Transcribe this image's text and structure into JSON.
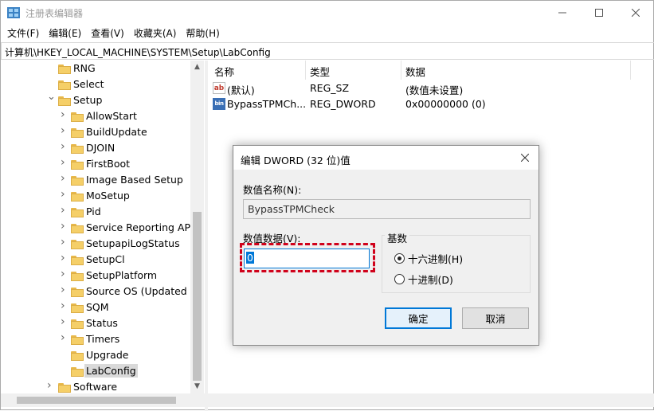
{
  "window": {
    "title": "注册表编辑器",
    "minimize": "—",
    "maximize": "☐",
    "close": "✕"
  },
  "menu": [
    "文件(F)",
    "编辑(E)",
    "查看(V)",
    "收藏夹(A)",
    "帮助(H)"
  ],
  "address": "计算机\\HKEY_LOCAL_MACHINE\\SYSTEM\\Setup\\LabConfig",
  "tree": [
    {
      "label": "RNG",
      "expander": "",
      "selected": false
    },
    {
      "label": "Select",
      "expander": "",
      "selected": false
    },
    {
      "label": "Setup",
      "expander": "expanded",
      "selected": false
    },
    {
      "label": "AllowStart",
      "expander": "collapsed",
      "selected": false
    },
    {
      "label": "BuildUpdate",
      "expander": "collapsed",
      "selected": false
    },
    {
      "label": "DJOIN",
      "expander": "collapsed",
      "selected": false
    },
    {
      "label": "FirstBoot",
      "expander": "collapsed",
      "selected": false
    },
    {
      "label": "Image Based Setup",
      "expander": "collapsed",
      "selected": false
    },
    {
      "label": "MoSetup",
      "expander": "collapsed",
      "selected": false
    },
    {
      "label": "Pid",
      "expander": "collapsed",
      "selected": false
    },
    {
      "label": "Service Reporting API",
      "expander": "collapsed",
      "selected": false
    },
    {
      "label": "SetupapiLogStatus",
      "expander": "collapsed",
      "selected": false
    },
    {
      "label": "SetupCl",
      "expander": "collapsed",
      "selected": false
    },
    {
      "label": "SetupPlatform",
      "expander": "collapsed",
      "selected": false
    },
    {
      "label": "Source OS (Updated c",
      "expander": "collapsed",
      "selected": false
    },
    {
      "label": "SQM",
      "expander": "collapsed",
      "selected": false
    },
    {
      "label": "Status",
      "expander": "collapsed",
      "selected": false
    },
    {
      "label": "Timers",
      "expander": "collapsed",
      "selected": false
    },
    {
      "label": "Upgrade",
      "expander": "",
      "selected": false
    },
    {
      "label": "LabConfig",
      "expander": "",
      "selected": true
    },
    {
      "label": "Software",
      "expander": "collapsed",
      "selected": false
    }
  ],
  "list": {
    "columns": [
      "名称",
      "类型",
      "数据"
    ],
    "rows": [
      {
        "icon": "ab",
        "name": "(默认)",
        "type": "REG_SZ",
        "data": "(数值未设置)"
      },
      {
        "icon": "bin",
        "name": "BypassTPMCh...",
        "type": "REG_DWORD",
        "data": "0x00000000 (0)"
      }
    ]
  },
  "dialog": {
    "title": "编辑 DWORD (32 位)值",
    "close": "✕",
    "name_label": "数值名称(N):",
    "name_value": "BypassTPMCheck",
    "data_label": "数值数据(V):",
    "data_value": "0",
    "base_label": "基数",
    "hex_label": "十六进制(H)",
    "dec_label": "十进制(D)",
    "hex_checked": true,
    "ok": "确定",
    "cancel": "取消"
  },
  "colors": {
    "highlight": "#d0021b",
    "accent": "#0078d7"
  }
}
